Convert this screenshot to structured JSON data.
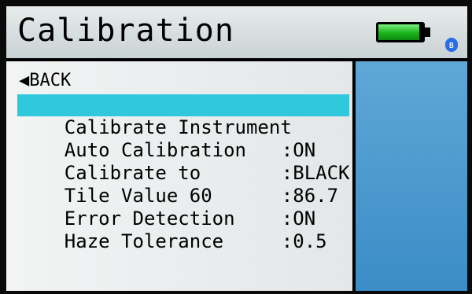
{
  "header": {
    "title": "Calibration",
    "battery_icon": "battery-full-icon",
    "bluetooth_icon": "bluetooth-icon"
  },
  "nav": {
    "back_label": "◀BACK"
  },
  "menu": {
    "items": [
      {
        "label": "Calibrate Instrument",
        "value": ""
      },
      {
        "label": "Auto Calibration",
        "value": ":ON"
      },
      {
        "label": "Calibrate to",
        "value": ":BLACK"
      },
      {
        "label": "Tile Value 60",
        "value": ":86.7"
      },
      {
        "label": "Error Detection",
        "value": ":ON"
      },
      {
        "label": "Haze Tolerance",
        "value": ":0.5"
      }
    ]
  },
  "colors": {
    "highlight": "#2fc8dd",
    "sidebar": "#4a9ad0",
    "battery": "#19b41c"
  }
}
